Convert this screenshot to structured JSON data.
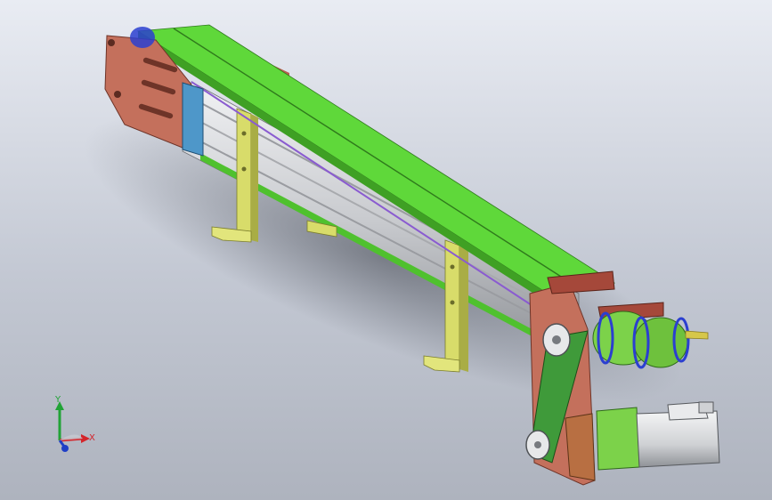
{
  "viewport": {
    "background_top": "#e9ecf3",
    "background_bottom": "#aeb3be"
  },
  "model": {
    "belt_color": "#5fd83a",
    "frame_plate_color": "#c4705c",
    "extrusion_color": "#d4d6d9",
    "leg_color": "#d8dc6a",
    "motor_flange_color": "#7cd24a",
    "motor_body_color": "#e3e4e6",
    "drive_arm_color": "#3f9a3a",
    "guide_block_color": "#4e97c9"
  },
  "triad": {
    "y_label": "Y",
    "x_label": "X",
    "x_color": "#d4242a",
    "y_color": "#21a336",
    "z_color": "#1f3fc6"
  }
}
